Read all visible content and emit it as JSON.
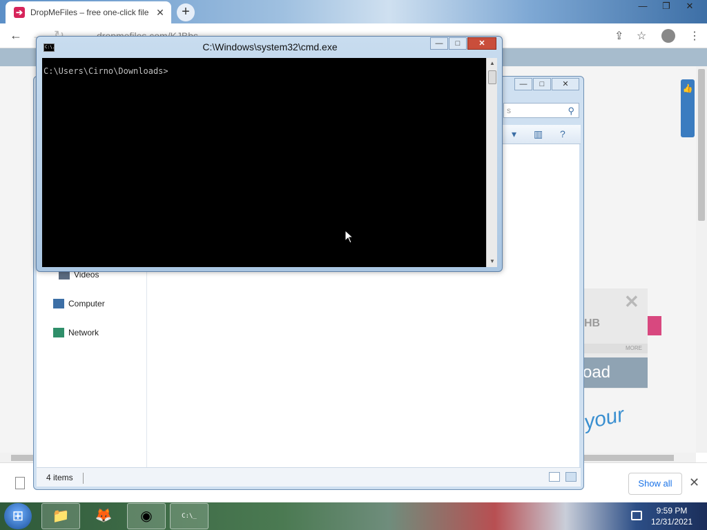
{
  "browser": {
    "tab_title": "DropMeFiles – free one-click file",
    "tab_close": "✕",
    "new_tab": "+",
    "window_buttons": [
      "—",
      "❐",
      "✕"
    ],
    "url": "dropmefiles.com/KJBbs",
    "show_all": "Show all",
    "ad_download": "oad",
    "ad_more": "MORE",
    "ad_brand": "HB",
    "handwriting": "your"
  },
  "explorer": {
    "search_placeholder": "s",
    "nav_items": [
      "Videos",
      "Computer",
      "Network"
    ],
    "status_items": "4 items"
  },
  "cmd": {
    "title": "C:\\Windows\\system32\\cmd.exe",
    "icon_text": "C:\\.",
    "prompt": "C:\\Users\\Cirno\\Downloads>"
  },
  "taskbar": {
    "time": "9:59 PM",
    "date": "12/31/2021",
    "cmd_button_text": "C:\\_"
  }
}
